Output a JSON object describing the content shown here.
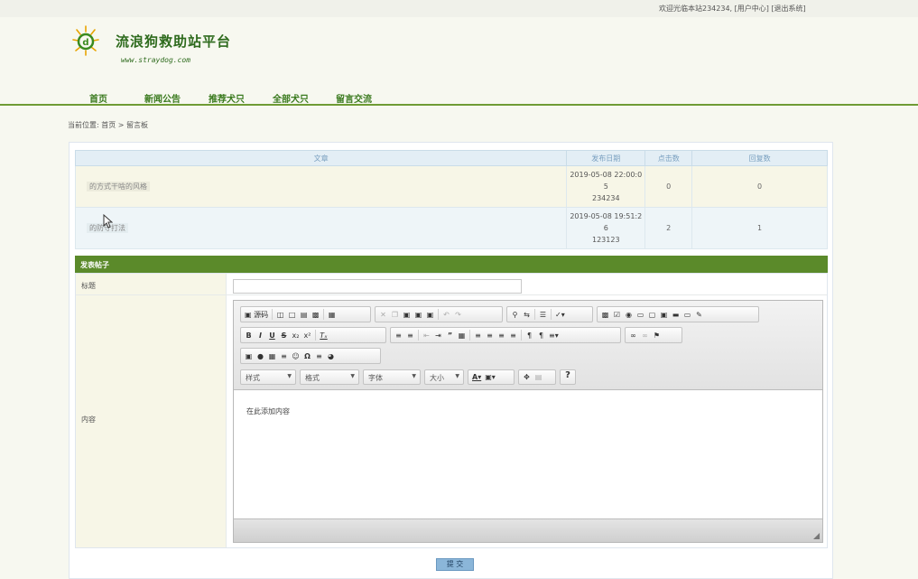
{
  "topbar": {
    "welcome": "欢迎光临本站234234,",
    "user_center": "[用户中心]",
    "logout": "[退出系统]"
  },
  "site": {
    "title": "流浪狗救助站平台",
    "url": "www.straydog.com",
    "brand_color": "#2d6a1c"
  },
  "nav": [
    "首页",
    "新闻公告",
    "推荐犬只",
    "全部犬只",
    "留言交流"
  ],
  "breadcrumb": "当前位置: 首页 > 留言板",
  "posts": {
    "headers": [
      "文章",
      "发布日期",
      "点击数",
      "回复数"
    ],
    "rows": [
      {
        "title": "的方式干啥的风格",
        "date": "2019-05-08 22:00:0",
        "date2": "5",
        "author": "234234",
        "clicks": "0",
        "replies": "0"
      },
      {
        "title": "的防守打法",
        "date": "2019-05-08 19:51:2",
        "date2": "6",
        "author": "123123",
        "clicks": "2",
        "replies": "1"
      }
    ]
  },
  "form": {
    "header": "发表帖子",
    "title_label": "标题",
    "content_label": "内容",
    "editor_placeholder": "在此添加内容",
    "submit": "提 交"
  },
  "editor": {
    "source_label": "源码",
    "style_combo": "样式",
    "format_combo": "格式",
    "font_combo": "字体",
    "size_combo": "大小",
    "help": "?"
  }
}
